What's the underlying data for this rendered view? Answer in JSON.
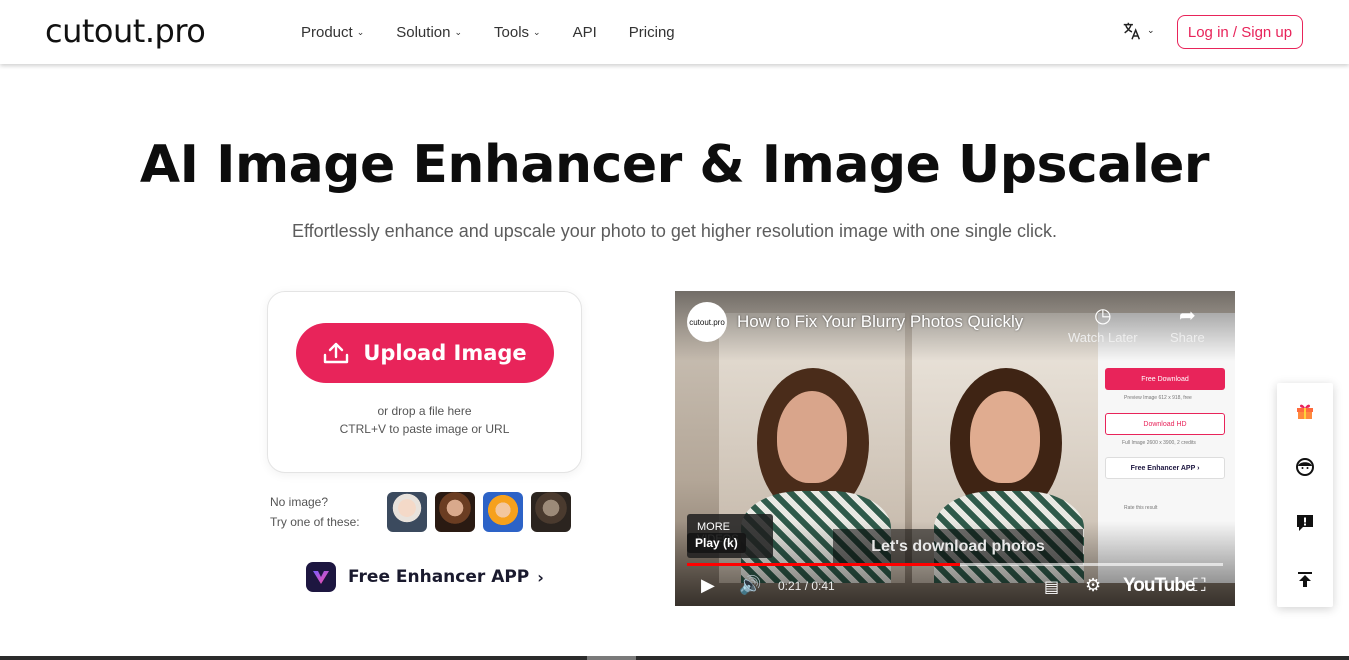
{
  "header": {
    "logo": "cutout.pro",
    "nav": [
      {
        "label": "Product",
        "has_dropdown": true
      },
      {
        "label": "Solution",
        "has_dropdown": true
      },
      {
        "label": "Tools",
        "has_dropdown": true
      },
      {
        "label": "API",
        "has_dropdown": false
      },
      {
        "label": "Pricing",
        "has_dropdown": false
      }
    ],
    "language_icon": "translate-icon",
    "login_label": "Log in / Sign up"
  },
  "hero": {
    "title": "AI Image Enhancer & Image Upscaler",
    "subtitle": "Effortlessly enhance and upscale your photo to get higher resolution image with one single click."
  },
  "upload": {
    "button_label": "Upload Image",
    "drop_line1": "or drop a file here",
    "drop_line2": "CTRL+V to paste image or URL",
    "try_line1": "No image?",
    "try_line2": "Try one of these:",
    "app_label": "Free Enhancer APP",
    "app_arrow": "›"
  },
  "video": {
    "channel": "cutout.pro",
    "title": "How to Fix Your Blurry Photos Quickly",
    "watch_later": "Watch Later",
    "share": "Share",
    "more_videos": "MORE VIDEOS",
    "play_tooltip": "Play (k)",
    "caption": "Let's download photos",
    "time": "0:21 / 0:41",
    "progress": 0.51,
    "youtube": "YouTube",
    "ui_free_download": "Free Download",
    "ui_preview_info": "Preview Image 612 x 918, free",
    "ui_download_hd": "Download HD",
    "ui_full_info": "Full Image 2600 x 3900, 2 credits",
    "ui_enhancer_app": "Free Enhancer APP ›",
    "ui_rate": "Rate this result"
  },
  "colors": {
    "accent": "#e8245a",
    "app_icon_bg": "#1d1640"
  }
}
